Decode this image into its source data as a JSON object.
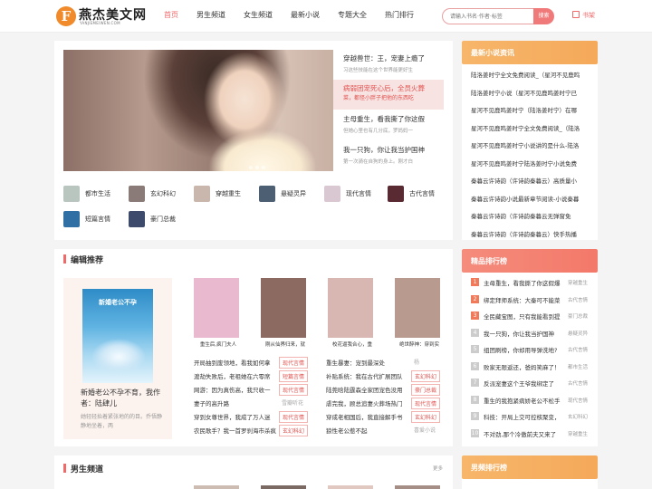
{
  "header": {
    "logo_name": "燕杰美文网",
    "logo_sub": "YANJIEMEIWEN.COM",
    "nav": [
      "首页",
      "男生频道",
      "女生频道",
      "最新小说",
      "专题大全",
      "热门排行"
    ],
    "search_placeholder": "请输入书名·作者·标签",
    "search_button": "搜索",
    "shelf": "书架"
  },
  "hero": {
    "items": [
      {
        "title": "穿越兽世：王，宠妻上瘾了",
        "desc": "习这些技能在这个世界能更好生"
      },
      {
        "title": "病弱团宠死心后，全员火葬",
        "desc": "菜，都怪小胖子把他的东西吃"
      },
      {
        "title": "主母重生，看我撕了你这假",
        "desc": "但她心里也有几分底，罗妈妈一"
      },
      {
        "title": "我一只狗，你让我当护国神",
        "desc": "第一次骑在自狗的身上。刚才白"
      }
    ]
  },
  "categories": [
    {
      "label": "都市生活",
      "color": "#b9c6c0"
    },
    {
      "label": "玄幻科幻",
      "color": "#8a7b78"
    },
    {
      "label": "穿越重生",
      "color": "#c9b7ad"
    },
    {
      "label": "悬疑灵异",
      "color": "#4d5f73"
    },
    {
      "label": "现代言情",
      "color": "#d9c8d2"
    },
    {
      "label": "古代言情",
      "color": "#5a2a33"
    },
    {
      "label": "短篇言情",
      "color": "#2f6fa3"
    },
    {
      "label": "豪门总裁",
      "color": "#3e4a6b"
    }
  ],
  "editor": {
    "title": "编辑推荐",
    "feature": {
      "cover_text": "新婚老公不孕",
      "title": "新婚老公不孕不育，我作者：陆肆儿",
      "desc": "她轻轻抬着紧张地的的目。乔悟静静地坐着，两"
    },
    "books": [
      {
        "title": "重生后,疯门夫人",
        "color": "#e9b9cf"
      },
      {
        "title": "刚从仙界归来，就",
        "color": "#8c6a62"
      },
      {
        "title": "校花逼我合心，重",
        "color": "#d8b7b3"
      },
      {
        "title": "绝世醉神：穿到实",
        "color": "#b99a8e"
      }
    ],
    "list_left": [
      {
        "title": "开局抽到废领地，看我如何拿",
        "tag": "现代言情",
        "red": true
      },
      {
        "title": "渡劫失败后，老祖她在六零席",
        "tag": "短篇言情",
        "red": true
      },
      {
        "title": "网游：因为真伤高，我只收一",
        "tag": "现代言情",
        "red": true
      },
      {
        "title": "妻子的高升路",
        "tag": "雪瓣听花",
        "red": false
      },
      {
        "title": "穿到女尊世界，我成了万人迷",
        "tag": "现代言情",
        "red": true
      },
      {
        "title": "农民歌手？我一首罗刹海市杀疯",
        "tag": "玄幻科幻",
        "red": true
      }
    ],
    "list_right": [
      {
        "title": "重生暴妻：宠到最深处",
        "tag": "杨",
        "red": false
      },
      {
        "title": "补贴系统：我在古代扩展团队",
        "tag": "玄幻科幻",
        "red": true
      },
      {
        "title": "陆莞晗陆霆森全家团宠色没用",
        "tag": "豪门总裁",
        "red": true
      },
      {
        "title": "虐完我，顾总追妻火葬场热门",
        "tag": "现代言情",
        "red": true
      },
      {
        "title": "穿成老相国后，我直接解手书",
        "tag": "玄幻科幻",
        "red": true
      },
      {
        "title": "狼性老公惹不起",
        "tag": "喜爱小说",
        "red": false
      }
    ]
  },
  "male": {
    "title": "男生频道",
    "more": "更多"
  },
  "news": {
    "title": "最新小说资讯",
    "items": [
      "陆洛姜时宁全文免费阅读_（星河不见鹿鸣",
      "陆洛姜时宁小说（星河不见鹿鸣姜时宁已",
      "星河不见鹿鸣姜时宁（陆洛姜时宁）在哪",
      "星河不见鹿鸣姜时宁全文免费阅读_（陆洛",
      "星河不见鹿鸣姜时宁小说讲的是什么-陆洛",
      "星河不见鹿鸣姜时宁陆洛姜时宁小说免费",
      "秦暮云许诗韵（许诗韵秦暮云）高质量小",
      "秦暮云许诗韵小说最新章节阅读-小说秦暮",
      "秦暮云许诗韵（许诗韵秦暮云无弹窗免",
      "秦暮云许诗韵（许诗韵秦暮云）快手热播"
    ]
  },
  "ranking": {
    "title": "精品排行榜",
    "items": [
      {
        "num": "1",
        "title": "主母重生，看我撕了你这假爆",
        "cat": "穿越重生"
      },
      {
        "num": "2",
        "title": "绑定拜师系统：大秦可不能菜",
        "cat": "古代言情"
      },
      {
        "num": "3",
        "title": "全民藏宝图，只有我能看到提",
        "cat": "豪门总裁"
      },
      {
        "num": "4",
        "title": "我一只狗，你让我当护国神",
        "cat": "悬疑灵异"
      },
      {
        "num": "5",
        "title": "组团刷榜，你却用导弹洗地?",
        "cat": "古代言情"
      },
      {
        "num": "6",
        "title": "败家无限返还，爸妈笑麻了！",
        "cat": "都市生活"
      },
      {
        "num": "7",
        "title": "反派宠妻这个王爷我绑定了",
        "cat": "古代言情"
      },
      {
        "num": "8",
        "title": "重生的我抱紧病娇老公不松手",
        "cat": "现代言情"
      },
      {
        "num": "9",
        "title": "科技：开局上交可控核聚变，",
        "cat": "玄幻科幻"
      },
      {
        "num": "10",
        "title": "不对劲,那个冷傲前夫又来了",
        "cat": "穿越重生"
      }
    ]
  },
  "male_rank": {
    "title": "男频排行榜"
  }
}
